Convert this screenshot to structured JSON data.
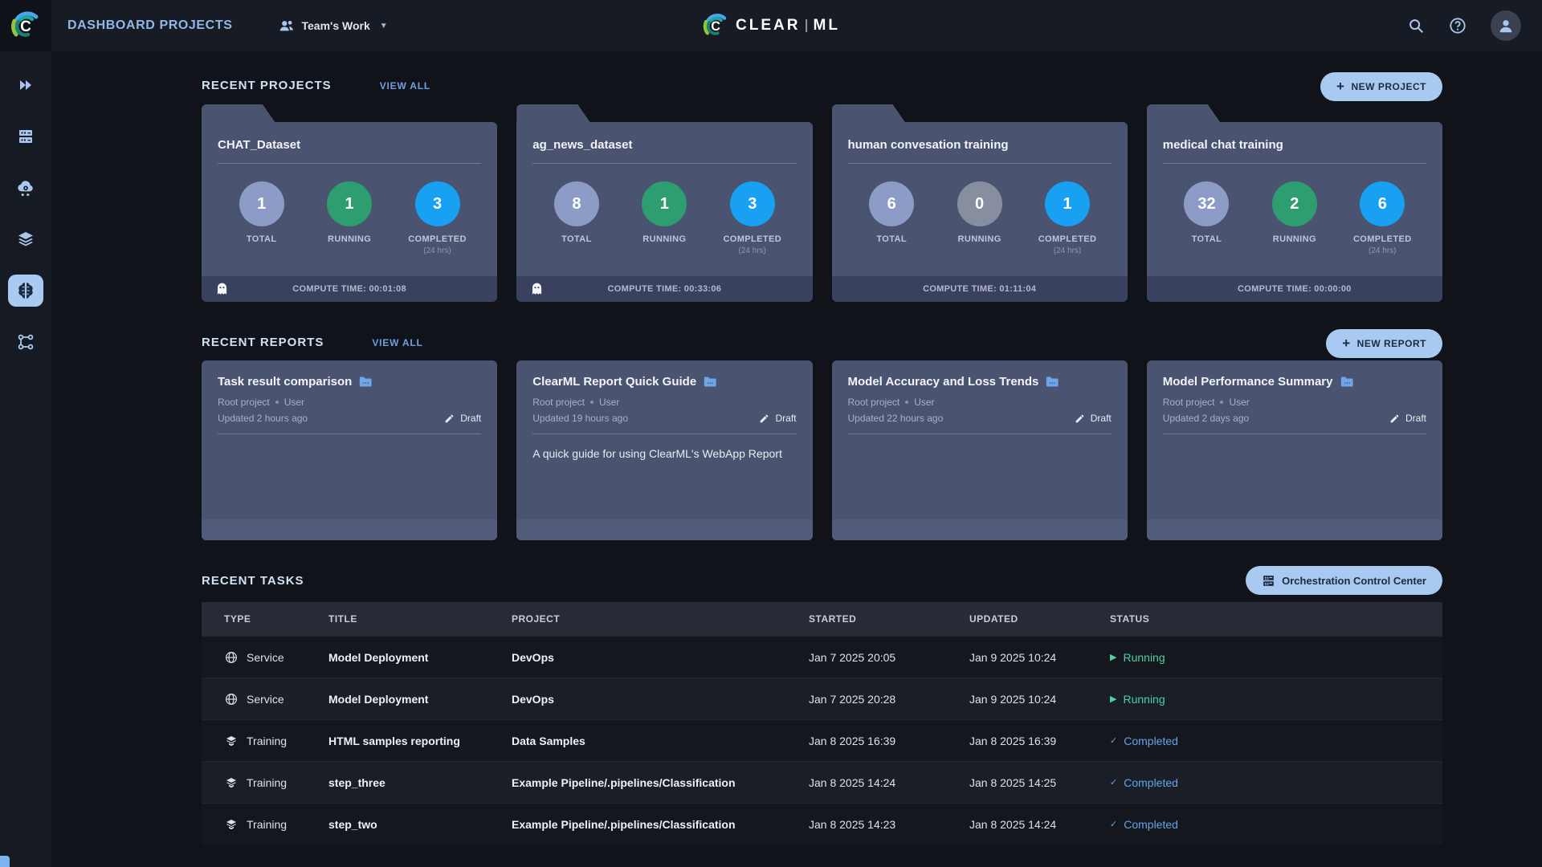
{
  "colors": {
    "accent_blue": "#8fb8e8",
    "button_bg": "#a8c9f0",
    "card_bg": "#4a5370",
    "running_green": "#4ed0a2",
    "completed_blue": "#66a4ea"
  },
  "header": {
    "title": "DASHBOARD PROJECTS",
    "workspace": "Team's Work",
    "brand_clear": "CLEAR",
    "brand_ml": "ML",
    "icons": [
      "users-icon",
      "search-icon",
      "help-icon",
      "avatar-icon"
    ]
  },
  "sidebar": {
    "items": [
      {
        "icon": "double-play-icon",
        "active": false
      },
      {
        "icon": "server-rack-icon",
        "active": false
      },
      {
        "icon": "cloud-gear-icon",
        "active": false
      },
      {
        "icon": "layers-icon",
        "active": false
      },
      {
        "icon": "brain-icon",
        "active": true
      },
      {
        "icon": "pipeline-icon",
        "active": false
      }
    ]
  },
  "recent_projects": {
    "heading": "RECENT PROJECTS",
    "view_all": "VIEW ALL",
    "new_button": "NEW PROJECT",
    "plus": "+"
  },
  "projects": [
    {
      "name": "CHAT_Dataset",
      "stats": [
        {
          "label": "TOTAL",
          "value": "1",
          "color": "#8d9bc7",
          "note": ""
        },
        {
          "label": "RUNNING",
          "value": "1",
          "color": "#2e9e70",
          "note": ""
        },
        {
          "label": "COMPLETED",
          "value": "3",
          "color": "#18a1f2",
          "note": "(24 hrs)"
        }
      ],
      "compute_time": "COMPUTE TIME: 00:01:08",
      "has_ghost": true
    },
    {
      "name": "ag_news_dataset",
      "stats": [
        {
          "label": "TOTAL",
          "value": "8",
          "color": "#8d9bc7",
          "note": ""
        },
        {
          "label": "RUNNING",
          "value": "1",
          "color": "#2e9e70",
          "note": ""
        },
        {
          "label": "COMPLETED",
          "value": "3",
          "color": "#18a1f2",
          "note": "(24 hrs)"
        }
      ],
      "compute_time": "COMPUTE TIME: 00:33:06",
      "has_ghost": true
    },
    {
      "name": "human convesation training",
      "stats": [
        {
          "label": "TOTAL",
          "value": "6",
          "color": "#8d9bc7",
          "note": ""
        },
        {
          "label": "RUNNING",
          "value": "0",
          "color": "#878e9f",
          "note": ""
        },
        {
          "label": "COMPLETED",
          "value": "1",
          "color": "#18a1f2",
          "note": "(24 hrs)"
        }
      ],
      "compute_time": "COMPUTE TIME: 01:11:04",
      "has_ghost": false
    },
    {
      "name": "medical chat training",
      "stats": [
        {
          "label": "TOTAL",
          "value": "32",
          "color": "#8d9bc7",
          "note": ""
        },
        {
          "label": "RUNNING",
          "value": "2",
          "color": "#2e9e70",
          "note": ""
        },
        {
          "label": "COMPLETED",
          "value": "6",
          "color": "#18a1f2",
          "note": "(24 hrs)"
        }
      ],
      "compute_time": "COMPUTE TIME: 00:00:00",
      "has_ghost": false
    }
  ],
  "recent_reports": {
    "heading": "RECENT REPORTS",
    "view_all": "VIEW ALL",
    "new_button": "NEW REPORT",
    "plus": "+"
  },
  "reports": [
    {
      "title": "Task result comparison",
      "project": "Root project",
      "user": "User",
      "updated": "Updated 2 hours ago",
      "badge": "Draft",
      "description": ""
    },
    {
      "title": "ClearML Report Quick Guide",
      "project": "Root project",
      "user": "User",
      "updated": "Updated 19 hours ago",
      "badge": "Draft",
      "description": "A quick guide for using ClearML's WebApp Report"
    },
    {
      "title": "Model Accuracy and Loss Trends",
      "project": "Root project",
      "user": "User",
      "updated": "Updated 22 hours ago",
      "badge": "Draft",
      "description": ""
    },
    {
      "title": "Model Performance Summary",
      "project": "Root project",
      "user": "User",
      "updated": "Updated 2 days ago",
      "badge": "Draft",
      "description": ""
    }
  ],
  "recent_tasks": {
    "heading": "RECENT TASKS",
    "orchestration_button": "Orchestration Control Center"
  },
  "table": {
    "columns": [
      "TYPE",
      "TITLE",
      "PROJECT",
      "STARTED",
      "UPDATED",
      "STATUS"
    ],
    "rows": [
      {
        "type": "Service",
        "type_icon": "globe-icon",
        "title": "Model Deployment",
        "project": "DevOps",
        "started": "Jan 7 2025 20:05",
        "updated": "Jan 9 2025 10:24",
        "status": "Running",
        "status_icon": "▶",
        "status_color": "#4ed0a2"
      },
      {
        "type": "Service",
        "type_icon": "globe-icon",
        "title": "Model Deployment",
        "project": "DevOps",
        "started": "Jan 7 2025 20:28",
        "updated": "Jan 9 2025 10:24",
        "status": "Running",
        "status_icon": "▶",
        "status_color": "#4ed0a2"
      },
      {
        "type": "Training",
        "type_icon": "layers-icon",
        "title": "HTML samples reporting",
        "project": "Data Samples",
        "started": "Jan 8 2025 16:39",
        "updated": "Jan 8 2025 16:39",
        "status": "Completed",
        "status_icon": "✓",
        "status_color": "#66a4ea"
      },
      {
        "type": "Training",
        "type_icon": "layers-icon",
        "title": "step_three",
        "project": "Example Pipeline/.pipelines/Classification",
        "started": "Jan 8 2025 14:24",
        "updated": "Jan 8 2025 14:25",
        "status": "Completed",
        "status_icon": "✓",
        "status_color": "#66a4ea"
      },
      {
        "type": "Training",
        "type_icon": "layers-icon",
        "title": "step_two",
        "project": "Example Pipeline/.pipelines/Classification",
        "started": "Jan 8 2025 14:23",
        "updated": "Jan 8 2025 14:24",
        "status": "Completed",
        "status_icon": "✓",
        "status_color": "#66a4ea"
      }
    ]
  }
}
